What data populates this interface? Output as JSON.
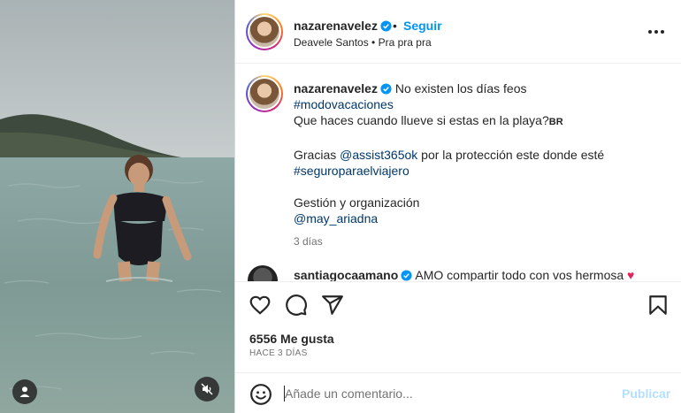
{
  "post": {
    "author": {
      "username": "nazarenavelez",
      "verified": true,
      "follow_label": "Seguir",
      "separator": "•",
      "location_line": "Deavele Santos • Pra pra pra"
    },
    "caption": {
      "username": "nazarenavelez",
      "line1": "No existen los días feos",
      "hashtag1": "#modovacaciones",
      "line2": "Que haces cuando llueve si estas en la playa?",
      "line2_suffix": "BR",
      "thanks_prefix": "Gracias",
      "mention1": "@assist365ok",
      "thanks_suffix": "por la protección este donde esté",
      "hashtag2": "#seguroparaelviajero",
      "management": "Gestión y organización",
      "mention2": "@may_ariadna",
      "time": "3 días"
    },
    "comments": [
      {
        "username": "santiagocaamano",
        "verified": true,
        "text": "AMO compartir todo con vos hermosa"
      }
    ],
    "likes": "6556 Me gusta",
    "posted_ago": "HACE 3 DÍAS"
  },
  "composer": {
    "placeholder": "Añade un comentario...",
    "post_label": "Publicar"
  },
  "icons": {
    "verified": "verified-badge-icon",
    "more": "more-options-icon",
    "like": "heart-icon",
    "comment": "comment-icon",
    "share": "send-icon",
    "save": "bookmark-icon",
    "emoji": "emoji-icon",
    "user_tag": "user-icon",
    "mute": "muted-speaker-icon"
  },
  "colors": {
    "link_blue": "#0095f6",
    "hashtag": "#00376b",
    "muted_text": "#737373",
    "post_disabled": "#b2dffc",
    "verified_blue": "#0095f6"
  }
}
